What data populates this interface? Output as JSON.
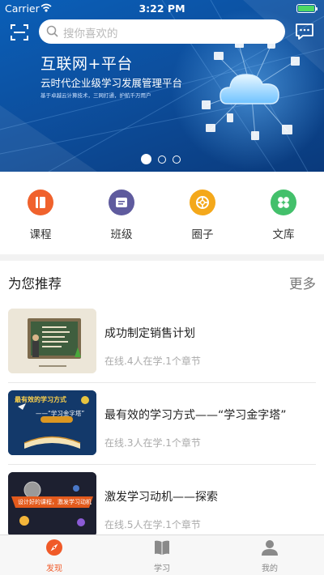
{
  "status_bar": {
    "carrier": "Carrier",
    "time": "3:22 PM"
  },
  "search": {
    "placeholder": "搜你喜欢的"
  },
  "banner": {
    "title": "互联网+平台",
    "subtitle": "云时代企业级学习发展管理平台",
    "small_text": "基于卓越云计算技术，三网打通，护航千万用户",
    "page_count": 3,
    "active_page": 1
  },
  "categories": [
    {
      "label": "课程",
      "icon": "course-book-icon",
      "color": "#f0622d"
    },
    {
      "label": "班级",
      "icon": "class-card-icon",
      "color": "#5f5b9e"
    },
    {
      "label": "圈子",
      "icon": "circle-group-icon",
      "color": "#f4a81b"
    },
    {
      "label": "文库",
      "icon": "library-clover-icon",
      "color": "#43c06b"
    }
  ],
  "recommend": {
    "title": "为您推荐",
    "more": "更多",
    "courses": [
      {
        "title": "成功制定销售计划",
        "meta": "在线.4人在学.1个章节"
      },
      {
        "title": "最有效的学习方式——“学习金字塔”",
        "meta": "在线.3人在学.1个章节",
        "thumb_text": "最有效的学习方式",
        "thumb_sub": "——“学习金字塔”"
      },
      {
        "title": "激发学习动机——探索",
        "meta": "在线.5人在学.1个章节",
        "thumb_text": "设计好的课程，激发学习动机"
      }
    ]
  },
  "tabs": [
    {
      "label": "发现",
      "icon": "compass-icon",
      "active": true
    },
    {
      "label": "学习",
      "icon": "book-icon",
      "active": false
    },
    {
      "label": "我的",
      "icon": "user-icon",
      "active": false
    }
  ],
  "colors": {
    "accent": "#f05a28",
    "banner_blue": "#0d4f9e"
  }
}
